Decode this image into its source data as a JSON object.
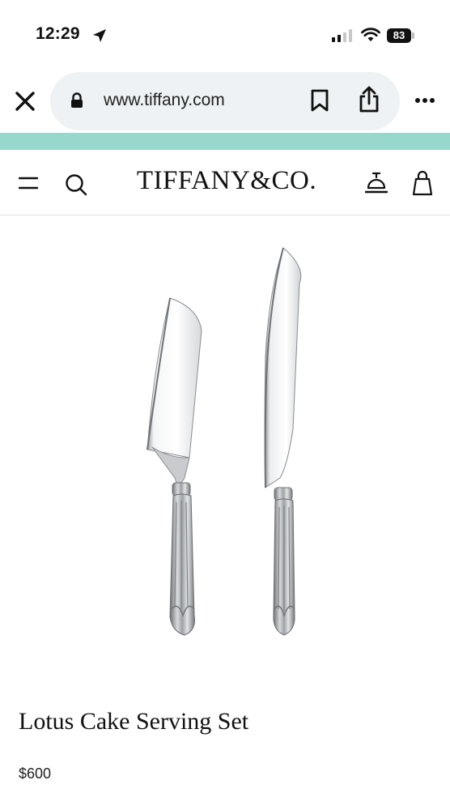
{
  "status_bar": {
    "time": "12:29",
    "battery": "83",
    "icons": [
      "location-arrow-icon",
      "cellular-signal-icon",
      "wifi-icon",
      "battery-icon"
    ]
  },
  "browser": {
    "url": "www.tiffany.com",
    "icons": [
      "close-icon",
      "lock-icon",
      "bookmark-icon",
      "share-icon",
      "more-icon"
    ]
  },
  "accent_colors": {
    "strip": "#98d8cc"
  },
  "site_header": {
    "brand": "TIFFANY&CO.",
    "icons": [
      "menu-icon",
      "search-icon",
      "service-bell-icon",
      "shopping-bag-icon"
    ]
  },
  "product": {
    "title": "Lotus Cake Serving Set",
    "price": "$600"
  }
}
